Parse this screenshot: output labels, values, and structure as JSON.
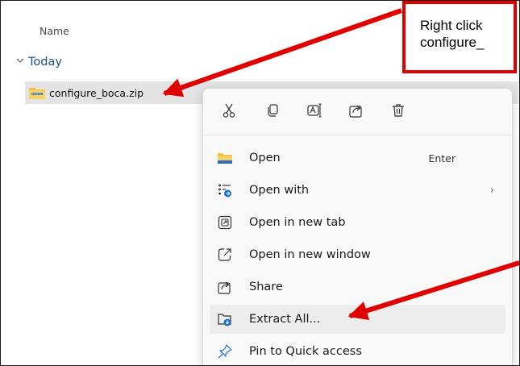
{
  "explorer": {
    "column_header": "Name",
    "group_label": "Today",
    "file_name": "configure_boca.zip"
  },
  "callout": {
    "line1": "Right click",
    "line2": "configure_"
  },
  "context_menu": {
    "quick_actions": [
      {
        "name": "cut-icon",
        "label": "Cut"
      },
      {
        "name": "copy-icon",
        "label": "Copy"
      },
      {
        "name": "rename-icon",
        "label": "Rename"
      },
      {
        "name": "share-icon",
        "label": "Share"
      },
      {
        "name": "delete-icon",
        "label": "Delete"
      }
    ],
    "items": [
      {
        "label": "Open",
        "shortcut": "Enter",
        "icon": "folder-icon"
      },
      {
        "label": "Open with",
        "submenu": "›",
        "icon": "open-with-icon"
      },
      {
        "label": "Open in new tab",
        "icon": "new-tab-icon"
      },
      {
        "label": "Open in new window",
        "icon": "new-window-icon"
      },
      {
        "label": "Share",
        "icon": "share-icon"
      },
      {
        "label": "Extract All...",
        "icon": "extract-icon"
      },
      {
        "label": "Pin to Quick access",
        "icon": "pin-icon"
      }
    ]
  },
  "colors": {
    "annotation_red": "#e00000",
    "selection_gray": "#e4e4e4",
    "group_blue": "#1b4d8c",
    "folder_yellow": "#f4c542"
  }
}
